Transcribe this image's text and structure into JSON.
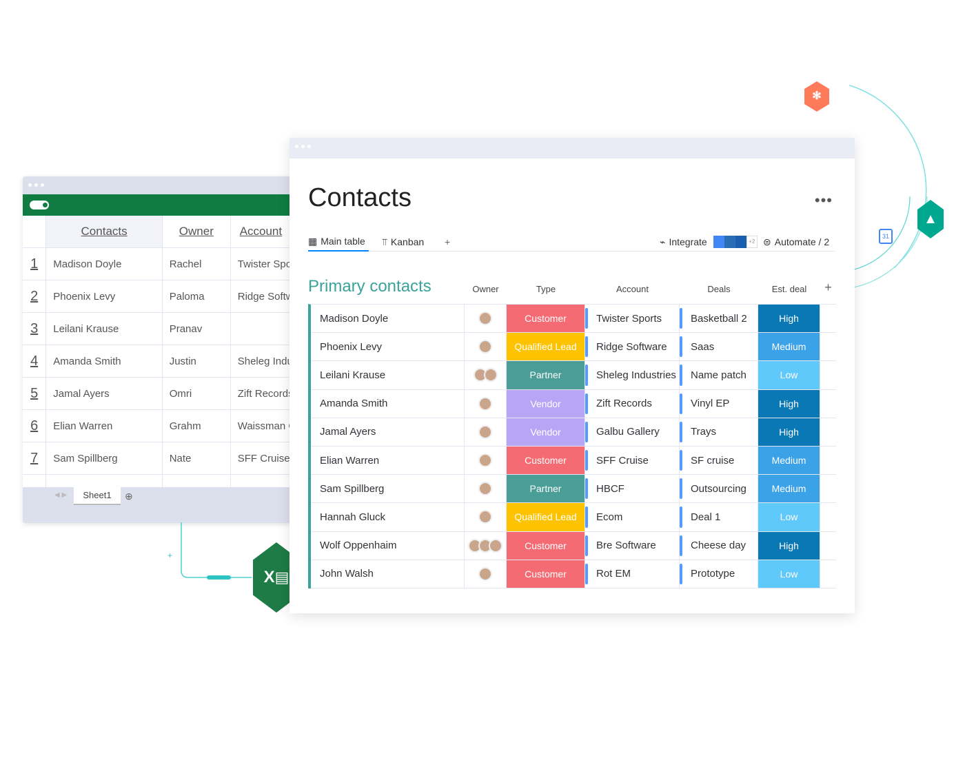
{
  "spreadsheet": {
    "headers": [
      "Contacts",
      "Owner",
      "Account"
    ],
    "rows": [
      {
        "n": "1",
        "contact": "Madison Doyle",
        "owner": "Rachel",
        "account": "Twister Sports"
      },
      {
        "n": "2",
        "contact": "Phoenix Levy",
        "owner": "Paloma",
        "account": "Ridge Software"
      },
      {
        "n": "3",
        "contact": "Leilani Krause",
        "owner": "Pranav",
        "account": ""
      },
      {
        "n": "4",
        "contact": "Amanda Smith",
        "owner": "Justin",
        "account": "Sheleg Industries"
      },
      {
        "n": "5",
        "contact": "Jamal Ayers",
        "owner": "Omri",
        "account": "Zift Records"
      },
      {
        "n": "6",
        "contact": "Elian Warren",
        "owner": "Grahm",
        "account": "Waissman G"
      },
      {
        "n": "7",
        "contact": "Sam Spillberg",
        "owner": "Nate",
        "account": "SFF Cruise"
      }
    ],
    "sheet_tab": "Sheet1",
    "excel_icon_text": "X"
  },
  "board": {
    "title": "Contacts",
    "more": "•••",
    "tabs": [
      "Main table",
      "Kanban",
      "+"
    ],
    "integrate": "Integrate",
    "integrate_more": "+2",
    "automate": "Automate / 2",
    "group": "Primary contacts",
    "columns": [
      "Owner",
      "Type",
      "Account",
      "Deals",
      "Est. deal",
      "+"
    ],
    "type_colors": {
      "Customer": "#f56b73",
      "Qualified Lead": "#fdc300",
      "Partner": "#4a9e97",
      "Vendor": "#b9a5f5"
    },
    "est_colors": {
      "High": "#0a78b4",
      "Medium": "#3ba2e8",
      "Low": "#5fc9fb"
    },
    "rows": [
      {
        "name": "Madison Doyle",
        "type": "Customer",
        "account": "Twister Sports",
        "deal": "Basketball 2",
        "est": "High",
        "owners": 1
      },
      {
        "name": "Phoenix Levy",
        "type": "Qualified Lead",
        "account": "Ridge Software",
        "deal": "Saas",
        "est": "Medium",
        "owners": 1
      },
      {
        "name": "Leilani Krause",
        "type": "Partner",
        "account": "Sheleg Industries",
        "deal": "Name patch",
        "est": "Low",
        "owners": 2
      },
      {
        "name": "Amanda Smith",
        "type": "Vendor",
        "account": "Zift Records",
        "deal": "Vinyl EP",
        "est": "High",
        "owners": 1
      },
      {
        "name": "Jamal Ayers",
        "type": "Vendor",
        "account": "Galbu Gallery",
        "deal": "Trays",
        "est": "High",
        "owners": 1
      },
      {
        "name": "Elian Warren",
        "type": "Customer",
        "account": "SFF Cruise",
        "deal": "SF cruise",
        "est": "Medium",
        "owners": 1
      },
      {
        "name": "Sam Spillberg",
        "type": "Partner",
        "account": "HBCF",
        "deal": "Outsourcing",
        "est": "Medium",
        "owners": 1
      },
      {
        "name": "Hannah Gluck",
        "type": "Qualified Lead",
        "account": "Ecom",
        "deal": "Deal 1",
        "est": "Low",
        "owners": 1
      },
      {
        "name": "Wolf Oppenhaim",
        "type": "Customer",
        "account": "Bre Software",
        "deal": "Cheese day",
        "est": "High",
        "owners": 3
      },
      {
        "name": "John Walsh",
        "type": "Customer",
        "account": "Rot EM",
        "deal": "Prototype",
        "est": "Low",
        "owners": 1
      }
    ]
  }
}
